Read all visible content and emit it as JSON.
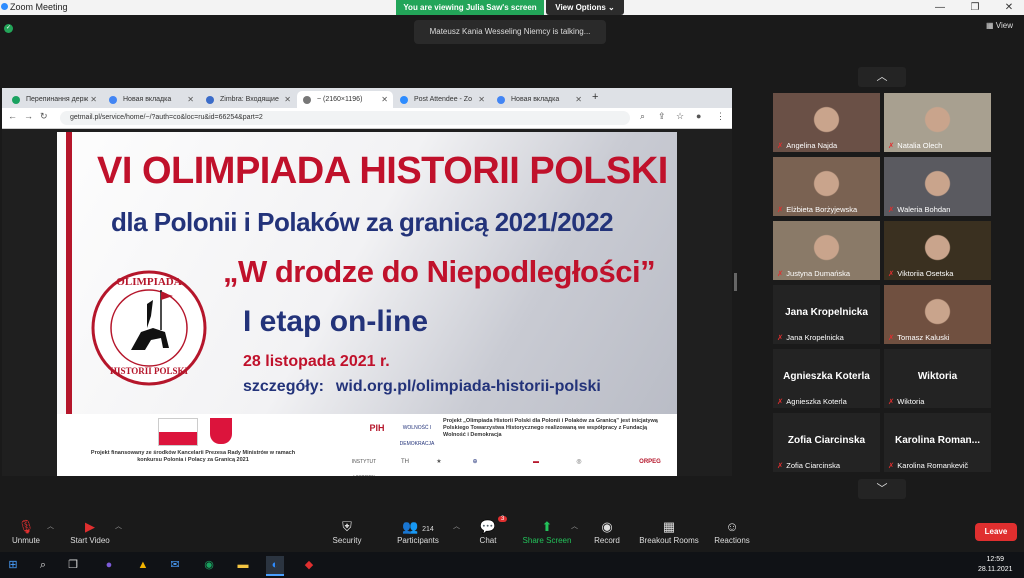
{
  "window": {
    "title": "Zoom Meeting",
    "minimize": "—",
    "maximize": "❐",
    "close": "✕"
  },
  "banner": {
    "viewing": "You are viewing Julia Saw's screen",
    "view_options": "View Options ⌄"
  },
  "talking": "Mateusz Kania Wesseling Niemcy is talking...",
  "view_button": "View",
  "browser": {
    "tabs": [
      {
        "label": "Перепинання держ",
        "color": "#1aa260"
      },
      {
        "label": "Новая вкладка",
        "color": "#4285f4"
      },
      {
        "label": "Zimbra: Входящие",
        "color": "#3b6cc9"
      },
      {
        "label": "~ (2160×1196)",
        "color": "#777777"
      },
      {
        "label": "Post Attendee - Zo",
        "color": "#2d8cff"
      },
      {
        "label": "Новая вкладка",
        "color": "#4285f4"
      }
    ],
    "url": "getmail.pl/service/home/~/?auth=co&loc=ru&id=66254&part=2"
  },
  "slide": {
    "title": "VI OLIMPIADA HISTORII POLSKI",
    "subtitle": "dla Polonii i Polaków za granicą 2021/2022",
    "motto": "„W drodze do Niepodległości”",
    "stage": "I etap on-line",
    "date": "28 listopada 2021 r.",
    "details_label": "szczegóły:",
    "details_url": "wid.org.pl/olimpiada-historii-polski",
    "badge_top": "OLIMPIADA",
    "badge_bottom": "HISTORII POLSKI",
    "funding": "Projekt finansowany ze środków Kancelarii Prezesa Rady Ministrów w ramach konkursu Polonia i Polacy za Granicą 2021",
    "project": "Projekt „Olimpiada Historii Polski dla Polonii i Polaków za Granicą” jest inicjatywą Polskiego Towarzystwa Historycznego realizowaną we współpracy z Fundacją Wolność i Demokracja",
    "logos": [
      "PIH",
      "WOLNOŚĆ I DEMOKRACJA",
      "INSTYTUT HISTORII",
      "TH",
      "★",
      "⊕",
      "▬",
      "◎",
      "ORPEG"
    ]
  },
  "participants": [
    {
      "name": "Angelina Najda",
      "video": true,
      "bg": "#6a5046"
    },
    {
      "name": "Natalia Olech",
      "video": true,
      "bg": "#a8a090"
    },
    {
      "name": "Elżbieta Borżyjewska",
      "video": true,
      "bg": "#7a6252"
    },
    {
      "name": "Waleria Bohdan",
      "video": true,
      "bg": "#5a5a60"
    },
    {
      "name": "Justyna Dumańska",
      "video": true,
      "bg": "#8a7a68"
    },
    {
      "name": "Viktoriia Osetska",
      "video": true,
      "bg": "#3a3020"
    },
    {
      "name": "Jana Kropelnicka",
      "video": false,
      "display": "Jana Kropelnicka"
    },
    {
      "name": "Tomasz Kaluski",
      "video": true,
      "bg": "#705040"
    },
    {
      "name": "Agnieszka Koterla",
      "video": false,
      "display": "Agnieszka Koterla"
    },
    {
      "name": "Wiktoria",
      "video": false,
      "display": "Wiktoria"
    },
    {
      "name": "Zofia Ciarcinska",
      "video": false,
      "display": "Zofia Ciarcinska"
    },
    {
      "name": "Karolina Romankevič",
      "video": false,
      "display": "Karolina Roman..."
    }
  ],
  "toolbar": {
    "unmute": "Unmute",
    "start_video": "Start Video",
    "security": "Security",
    "participants": "Participants",
    "participants_count": "214",
    "chat": "Chat",
    "chat_badge": "3",
    "share_screen": "Share Screen",
    "record": "Record",
    "breakout": "Breakout Rooms",
    "reactions": "Reactions",
    "leave": "Leave"
  },
  "taskbar": {
    "time": "12:59",
    "date": "28.11.2021"
  }
}
